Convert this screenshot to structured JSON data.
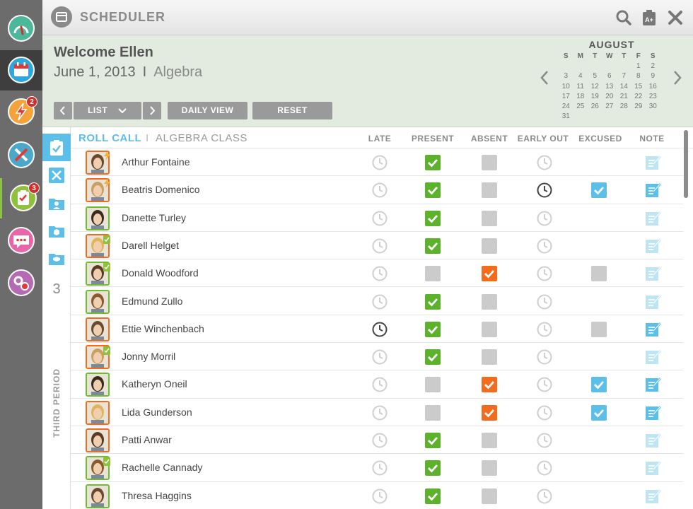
{
  "app": {
    "title": "SCHEDULER",
    "rail": [
      {
        "icon": "dashboard-gauge-icon",
        "color": "#4cb89a",
        "badge": ""
      },
      {
        "icon": "calendar-icon",
        "color": "#2ea7de",
        "badge": ""
      },
      {
        "icon": "lightning-alert-icon",
        "color": "#f3a33a",
        "badge": "2"
      },
      {
        "icon": "tools-icon",
        "color": "#4aa9c9",
        "badge": ""
      },
      {
        "icon": "roll-call-clipboard-icon",
        "color": "#8fc13c",
        "badge": "3"
      },
      {
        "icon": "chat-bubble-icon",
        "color": "#e965a8",
        "badge": ""
      },
      {
        "icon": "settings-gears-icon",
        "color": "#b56bb4",
        "badge": ""
      }
    ]
  },
  "header": {
    "welcome": "Welcome Ellen",
    "date": "June 1, 2013",
    "separator": "I",
    "subject": "Algebra",
    "buttons": {
      "list": "LIST",
      "daily_view": "DAILY VIEW",
      "reset": "RESET"
    }
  },
  "calendar": {
    "month": "AUGUST",
    "weekdays": [
      "S",
      "M",
      "T",
      "W",
      "T",
      "F",
      "S"
    ],
    "days": [
      "",
      "",
      "",
      "",
      "",
      "1",
      "2",
      "3",
      "4",
      "5",
      "6",
      "7",
      "8",
      "9",
      "10",
      "11",
      "12",
      "13",
      "14",
      "15",
      "16",
      "17",
      "18",
      "19",
      "20",
      "21",
      "22",
      "23",
      "24",
      "25",
      "26",
      "27",
      "28",
      "29",
      "30",
      "31",
      "",
      "",
      "",
      "",
      "",
      ""
    ]
  },
  "sidebar": {
    "period_number": "3",
    "period_label": "THIRD PERIOD"
  },
  "roll": {
    "title": "ROLL CALL",
    "bar": "I",
    "subtitle": "ALGEBRA CLASS",
    "columns": {
      "late": "LATE",
      "present": "PRESENT",
      "absent": "ABSENT",
      "early_out": "EARLY OUT",
      "excused": "EXCUSED",
      "note": "NOTE"
    },
    "students": [
      {
        "name": "Arthur Fontaine",
        "frame": "orange",
        "badge": "lightning",
        "late": false,
        "present": true,
        "absent": false,
        "early_out": false,
        "excused": "none",
        "note_active": false
      },
      {
        "name": "Beatris Domenico",
        "frame": "orange",
        "badge": "lightning",
        "late": false,
        "present": true,
        "absent": false,
        "early_out": true,
        "excused": "checked",
        "note_active": true
      },
      {
        "name": "Danette Turley",
        "frame": "green",
        "badge": "",
        "late": false,
        "present": true,
        "absent": false,
        "early_out": false,
        "excused": "none",
        "note_active": false
      },
      {
        "name": "Darell Helget",
        "frame": "orange",
        "badge": "clipboard",
        "late": false,
        "present": true,
        "absent": false,
        "early_out": false,
        "excused": "none",
        "note_active": false
      },
      {
        "name": "Donald Woodford",
        "frame": "green",
        "badge": "clipboard",
        "late": false,
        "present": false,
        "absent": true,
        "early_out": false,
        "excused": "empty",
        "note_active": false
      },
      {
        "name": "Edmund Zullo",
        "frame": "green",
        "badge": "",
        "late": false,
        "present": true,
        "absent": false,
        "early_out": false,
        "excused": "none",
        "note_active": false
      },
      {
        "name": "Ettie Winchenbach",
        "frame": "orange",
        "badge": "",
        "late": true,
        "present": true,
        "absent": false,
        "early_out": false,
        "excused": "empty",
        "note_active": true
      },
      {
        "name": "Jonny Morril",
        "frame": "orange",
        "badge": "clipboard",
        "late": false,
        "present": true,
        "absent": false,
        "early_out": false,
        "excused": "none",
        "note_active": false
      },
      {
        "name": "Katheryn Oneil",
        "frame": "green",
        "badge": "",
        "late": false,
        "present": false,
        "absent": true,
        "early_out": false,
        "excused": "checked",
        "note_active": true
      },
      {
        "name": "Lida Gunderson",
        "frame": "orange",
        "badge": "",
        "late": false,
        "present": false,
        "absent": true,
        "early_out": false,
        "excused": "checked",
        "note_active": true
      },
      {
        "name": "Patti Anwar",
        "frame": "orange",
        "badge": "",
        "late": false,
        "present": true,
        "absent": false,
        "early_out": false,
        "excused": "none",
        "note_active": false
      },
      {
        "name": "Rachelle Cannady",
        "frame": "green",
        "badge": "clipboard",
        "late": false,
        "present": true,
        "absent": false,
        "early_out": false,
        "excused": "none",
        "note_active": false
      },
      {
        "name": "Thresa Haggins",
        "frame": "green",
        "badge": "",
        "late": false,
        "present": true,
        "absent": false,
        "early_out": false,
        "excused": "none",
        "note_active": false
      }
    ]
  },
  "colors": {
    "accent_blue": "#5bbfe9",
    "present_green": "#5cb32b",
    "absent_orange": "#f26c1d",
    "inactive_gray": "#cbcbcb",
    "frame_orange": "#f26c1d",
    "frame_green": "#6cbf2a"
  }
}
